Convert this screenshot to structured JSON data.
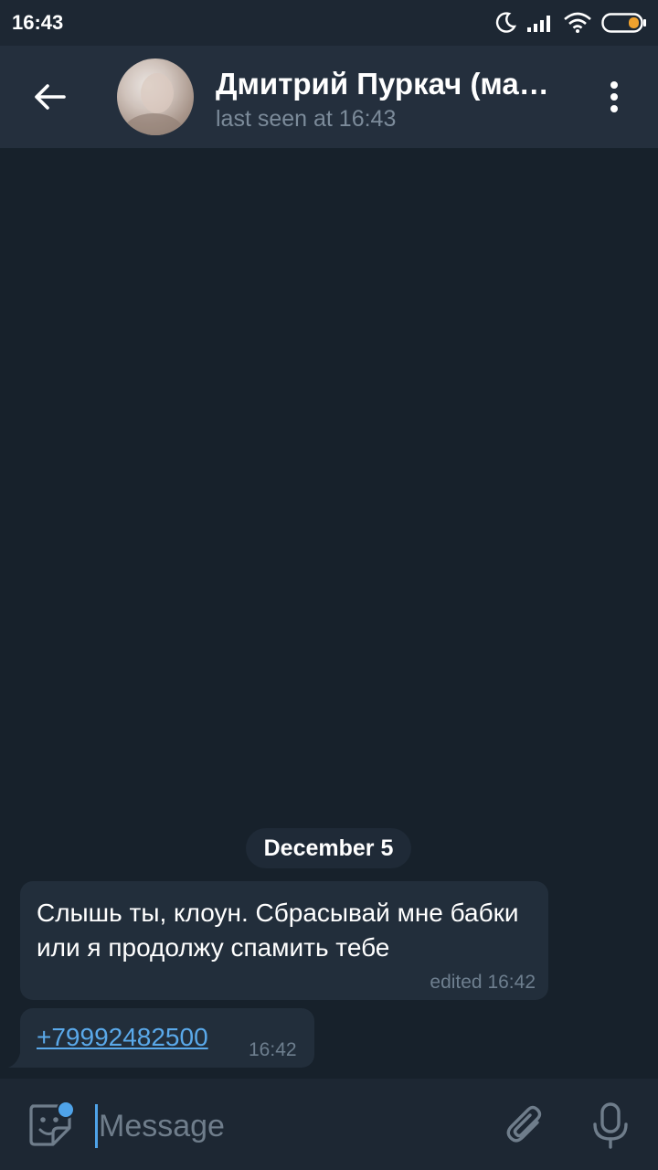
{
  "status_bar": {
    "time": "16:43",
    "icons": [
      "moon-icon",
      "signal-icon",
      "wifi-icon",
      "battery-icon"
    ]
  },
  "header": {
    "back_icon": "arrow-left-icon",
    "contact_name": "Дмитрий Пуркач (ма…",
    "contact_status": "last seen at 16:43",
    "menu_icon": "more-vertical-icon"
  },
  "chat": {
    "date_label": "December 5",
    "messages": [
      {
        "text": "Слышь ты, клоун. Сбрасывай мне бабки или я продолжу спамить тебе",
        "time": "edited 16:42"
      },
      {
        "link": "+79992482500",
        "time": "16:42"
      }
    ]
  },
  "input_bar": {
    "placeholder": "Message",
    "value": "",
    "icons": [
      "sticker-icon",
      "paperclip-icon",
      "microphone-icon"
    ]
  },
  "colors": {
    "background": "#17212b",
    "header": "#242f3d",
    "bubble": "#222e3b",
    "accent": "#4fa3e9",
    "link": "#5aa9ea",
    "battery": "#f0a22e"
  }
}
